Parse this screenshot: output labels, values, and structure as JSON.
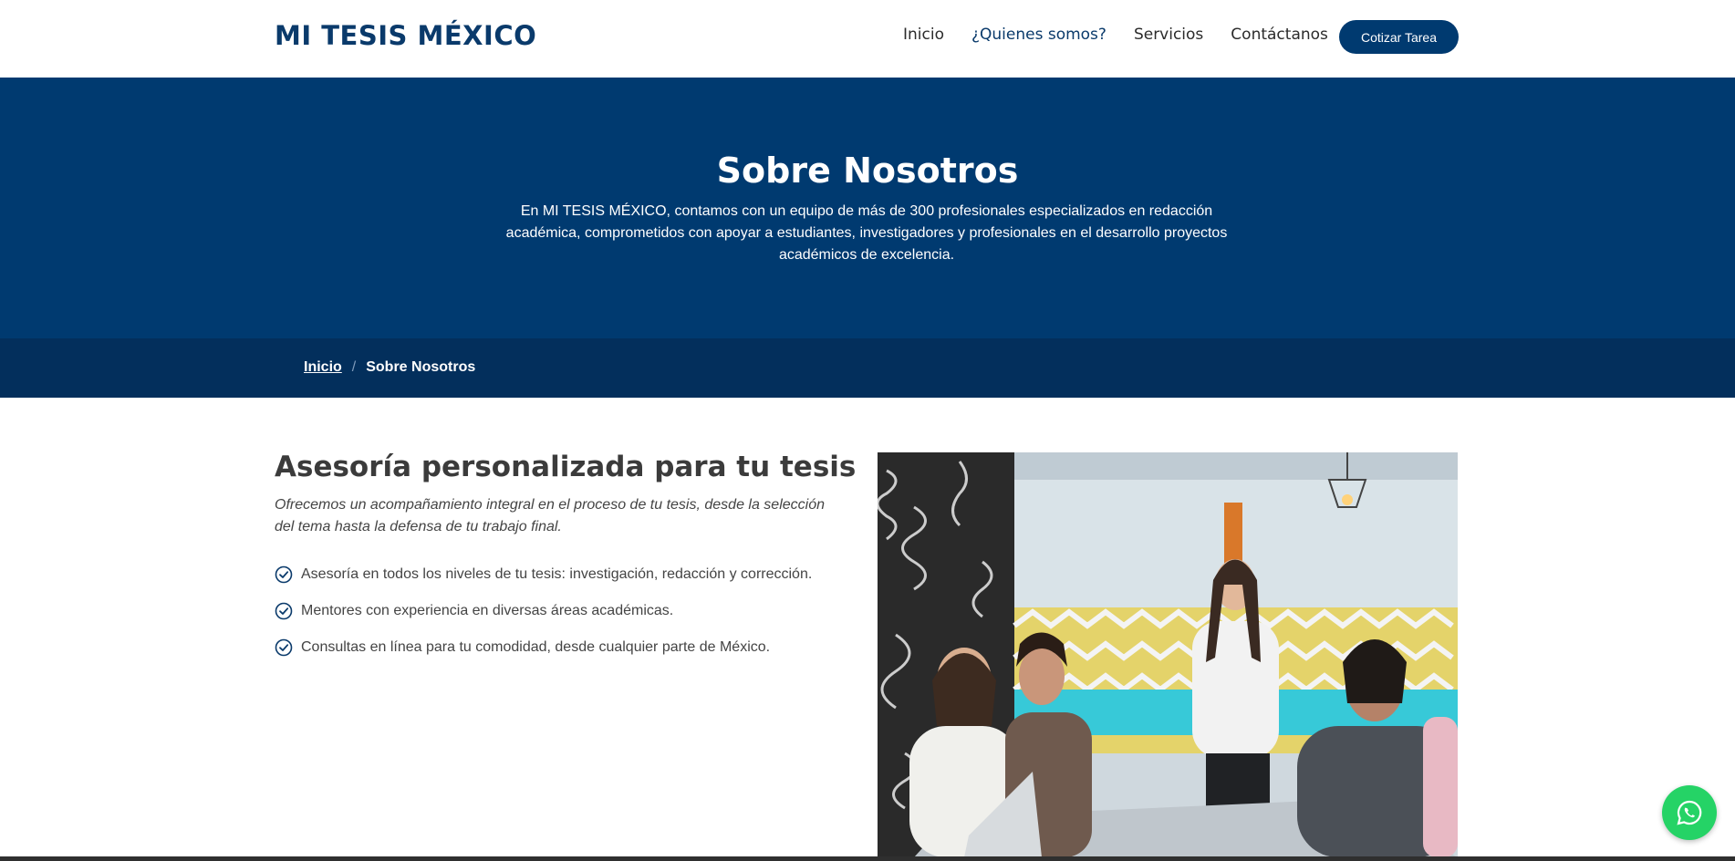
{
  "header": {
    "logo": "MI TESIS MÉXICO",
    "nav": [
      "Inicio",
      "¿Quienes somos?",
      "Servicios",
      "Contáctanos"
    ],
    "cta_label": "Cotizar Tarea"
  },
  "hero": {
    "title": "Sobre Nosotros",
    "text": "En MI TESIS MÉXICO, contamos con un equipo de más de 300 profesionales especializados en redacción académica, comprometidos con apoyar a estudiantes, investigadores y profesionales en el desarrollo proyectos académicos de excelencia."
  },
  "breadcrumb": {
    "home": "Inicio",
    "separator": "/",
    "current": "Sobre Nosotros"
  },
  "content": {
    "title": "Asesoría personalizada para tu tesis",
    "intro": "Ofrecemos un acompañamiento integral en el proceso de tu tesis, desde la selección del tema hasta la defensa de tu trabajo final.",
    "features": [
      "Asesoría en todos los niveles de tu tesis: investigación, redacción y corrección.",
      "Mentores con experiencia en diversas áreas académicas.",
      "Consultas en línea para tu comodidad, desde cualquier parte de México."
    ]
  },
  "icons": {
    "check": "check-circle-icon",
    "whatsapp": "whatsapp-icon"
  },
  "colors": {
    "primary": "#003a70",
    "breadcrumb_bg": "#032f5c",
    "whatsapp": "#25d366"
  }
}
